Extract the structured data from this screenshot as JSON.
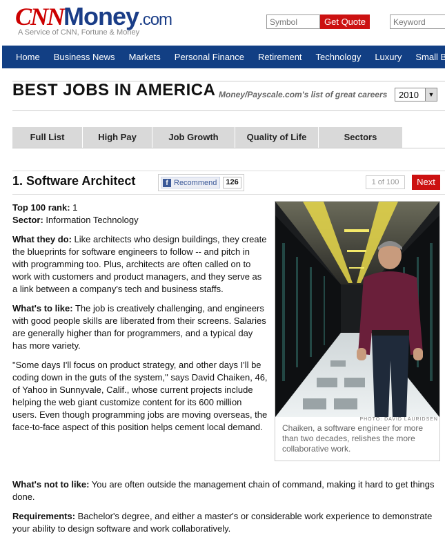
{
  "header": {
    "logo_cnn": "CNN",
    "logo_money": "Money",
    "logo_com": ".com",
    "tagline": "A Service of CNN, Fortune & Money",
    "symbol_placeholder": "Symbol",
    "quote_button": "Get Quote",
    "keyword_placeholder": "Keyword"
  },
  "nav": {
    "items": [
      "Home",
      "Business News",
      "Markets",
      "Personal Finance",
      "Retirement",
      "Technology",
      "Luxury",
      "Small Busi"
    ]
  },
  "page": {
    "title": "BEST JOBS IN AMERICA",
    "subtitle": "Money/Payscale.com's list of great careers",
    "year": "2010"
  },
  "tabs": [
    "Full List",
    "High Pay",
    "Job Growth",
    "Quality of Life",
    "Sectors"
  ],
  "article": {
    "title": "1. Software Architect",
    "recommend_label": "Recommend",
    "recommend_count": "126",
    "pager": "1 of 100",
    "next_label": "Next",
    "rank_label": "Top 100 rank:",
    "rank_value": " 1",
    "sector_label": "Sector:",
    "sector_value": " Information Technology",
    "what_they_do_label": "What they do:",
    "what_they_do": " Like architects who design buildings, they create the blueprints for software engineers to follow -- and pitch in with programming too. Plus, architects are often called on to work with customers and product managers, and they serve as a link between a company's tech and business staffs.",
    "whats_to_like_label": "What's to like:",
    "whats_to_like": " The job is creatively challenging, and engineers with good people skills are liberated from their screens. Salaries are generally higher than for programmers, and a typical day has more variety.",
    "quote": "\"Some days I'll focus on product strategy, and other days I'll be coding down in the guts of the system,\" says David Chaiken, 46, of Yahoo in Sunnyvale, Calif., whose current projects include helping the web giant customize content for its 600 million users. Even though programming jobs are moving overseas, the face-to-face aspect of this position helps cement local demand.",
    "whats_not_label": "What's not to like:",
    "whats_not": " You are often outside the management chain of command, making it hard to get things done.",
    "requirements_label": "Requirements:",
    "requirements": " Bachelor's degree, and either a master's or considerable work experience to demonstrate your ability to design software and work collaboratively."
  },
  "photo": {
    "credit": "PHOTO: DAVID LAURIDSEN",
    "caption": "Chaiken, a software engineer for more than two decades, relishes the more collaborative work."
  },
  "colors": {
    "brand_red": "#cc0000",
    "brand_blue": "#1a3d87",
    "nav_bg": "#123f84",
    "button_red": "#cc1111",
    "tab_bg": "#d9d9d9"
  }
}
